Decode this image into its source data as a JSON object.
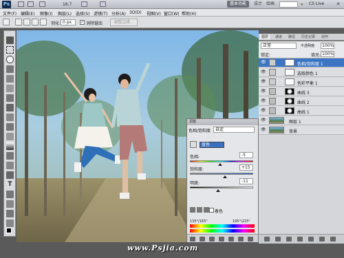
{
  "titlebar": {
    "app_logo": "Ps",
    "zoom": "16.7",
    "workspaces": [
      "基本功能",
      "设计",
      "绘画",
      "摄影"
    ],
    "more": "»",
    "cs_live": "CS Live"
  },
  "menu": [
    "文件(F)",
    "编辑(E)",
    "图像(I)",
    "图层(L)",
    "选择(S)",
    "滤镜(T)",
    "分析(A)",
    "3D(D)",
    "视图(V)",
    "窗口(W)",
    "帮助(H)"
  ],
  "options": {
    "feather_label": "羽化:",
    "feather_value": "0 px",
    "antialias_label": "消除锯齿",
    "refine_edge": "调整边缘..."
  },
  "panel_tabs": [
    "图层",
    "通道",
    "路径",
    "历史记录",
    "动作"
  ],
  "layers_panel": {
    "blend_mode": "正常",
    "opacity_label": "不透明度:",
    "opacity": "100%",
    "lock_label": "锁定:",
    "fill_label": "填充:",
    "fill": "100%",
    "layers": [
      {
        "name": "色相/饱和度 1",
        "selected": true,
        "type": "adj"
      },
      {
        "name": "选取颜色 1",
        "selected": false,
        "type": "adj"
      },
      {
        "name": "色彩平衡 1",
        "selected": false,
        "type": "adj"
      },
      {
        "name": "曲线 3",
        "selected": false,
        "type": "curve"
      },
      {
        "name": "曲线 2",
        "selected": false,
        "type": "curve"
      },
      {
        "name": "曲线 1",
        "selected": false,
        "type": "curve"
      },
      {
        "name": "图层 1",
        "selected": false,
        "type": "image"
      },
      {
        "name": "背景",
        "selected": false,
        "type": "image"
      }
    ]
  },
  "adjustments": {
    "title": "调整",
    "subtitle": "色相/饱和度",
    "preset": "自定",
    "edit": "蓝色",
    "hue_label": "色相:",
    "hue_value": "-5",
    "hue_level": 0.48,
    "sat_label": "饱和度:",
    "sat_value": "+15",
    "sat_level": 0.55,
    "light_label": "明度:",
    "light_value": "-11",
    "light_level": 0.45,
    "colorize_label": "着色",
    "range_left": "135°/165°",
    "range_right": "195°\\225°"
  },
  "watermark": "www.Psjia.com",
  "colors": {
    "selected_layer": "#3b75c4",
    "panel_bg": "#d4d6da"
  }
}
